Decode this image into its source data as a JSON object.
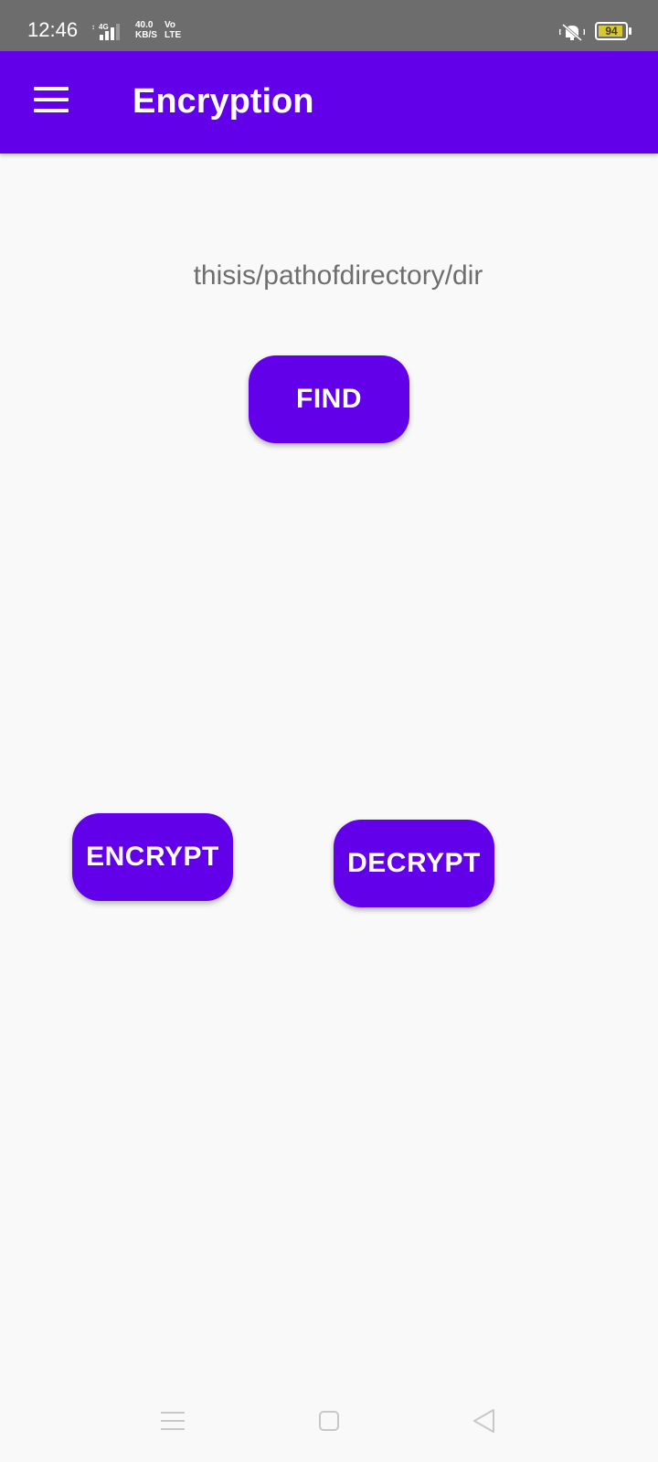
{
  "status_bar": {
    "time": "12:46",
    "network_type": "4G",
    "net_speed": "40.0",
    "net_speed_unit": "KB/S",
    "volte": "Vo",
    "lte": "LTE",
    "battery_level": "94",
    "battery_fraction": 0.94,
    "icons": [
      "signal-icon",
      "silent-bell-icon",
      "battery-icon"
    ]
  },
  "app_bar": {
    "title": "Encryption",
    "menu_icon": "hamburger-menu-icon",
    "background": "#6200ea"
  },
  "main": {
    "path": "thisis/pathofdirectory/dir",
    "find_label": "FIND",
    "encrypt_label": "ENCRYPT",
    "decrypt_label": "DECRYPT",
    "button_color": "#6200ea"
  },
  "nav_bar": {
    "icons": [
      "recent-apps-icon",
      "home-icon",
      "back-icon"
    ]
  }
}
